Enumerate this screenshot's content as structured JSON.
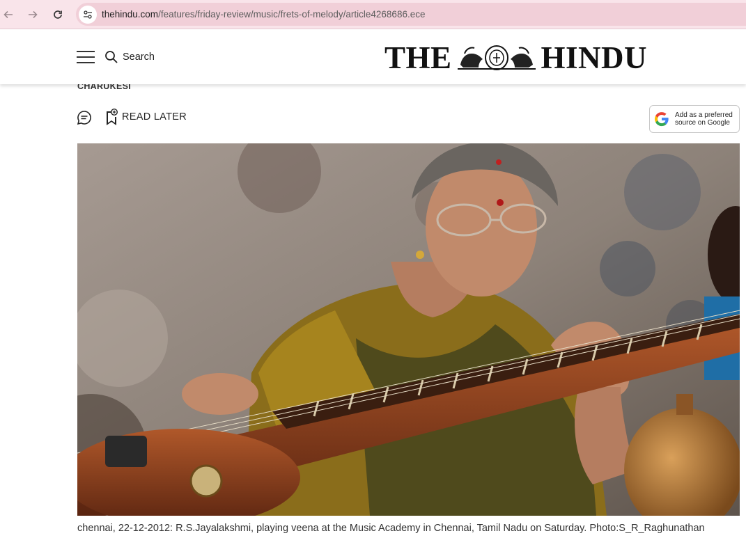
{
  "browser": {
    "url_host": "thehindu.com",
    "url_path": "/features/friday-review/music/frets-of-melody/article4268686.ece"
  },
  "header": {
    "search_label": "Search",
    "logo_left": "THE",
    "logo_right": "HINDU"
  },
  "article": {
    "author": "CHARUKESI",
    "read_later_label": "READ LATER",
    "google_pref_line1": "Add as a preferred",
    "google_pref_line2": "source on Google",
    "caption": "chennai, 22-12-2012: R.S.Jayalakshmi, playing veena at the Music Academy in Chennai, Tamil Nadu on Saturday. Photo:S_R_Raghunathan"
  }
}
